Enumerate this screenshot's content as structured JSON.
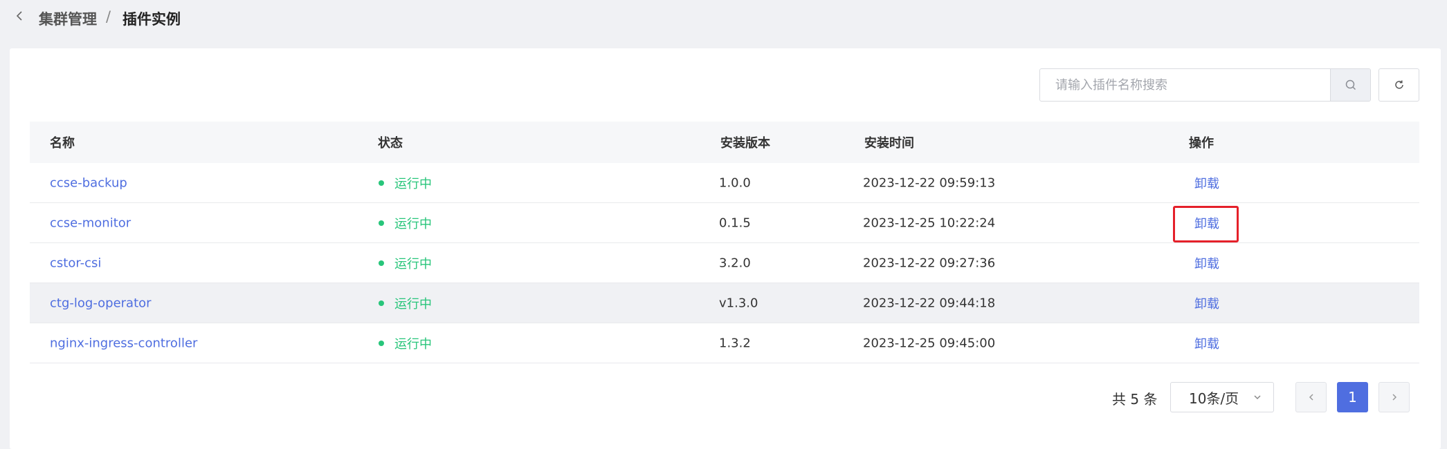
{
  "breadcrumb": {
    "parent": "集群管理",
    "separator": "/",
    "current": "插件实例"
  },
  "search": {
    "placeholder": "请输入插件名称搜索",
    "value": ""
  },
  "table": {
    "columns": [
      "名称",
      "状态",
      "安装版本",
      "安装时间",
      "操作"
    ],
    "rows": [
      {
        "name": "ccse-backup",
        "status": "运行中",
        "version": "1.0.0",
        "time": "2023-12-22 09:59:13",
        "action": "卸载"
      },
      {
        "name": "ccse-monitor",
        "status": "运行中",
        "version": "0.1.5",
        "time": "2023-12-25 10:22:24",
        "action": "卸载"
      },
      {
        "name": "cstor-csi",
        "status": "运行中",
        "version": "3.2.0",
        "time": "2023-12-22 09:27:36",
        "action": "卸载"
      },
      {
        "name": "ctg-log-operator",
        "status": "运行中",
        "version": "v1.3.0",
        "time": "2023-12-22 09:44:18",
        "action": "卸载"
      },
      {
        "name": "nginx-ingress-controller",
        "status": "运行中",
        "version": "1.3.2",
        "time": "2023-12-25 09:45:00",
        "action": "卸载"
      }
    ]
  },
  "pagination": {
    "total_text": "共 5 条",
    "page_size": "10条/页",
    "current_page": "1"
  },
  "colors": {
    "accent": "#4f6ee0",
    "status_running": "#27c57a",
    "highlight": "#e5202a"
  }
}
